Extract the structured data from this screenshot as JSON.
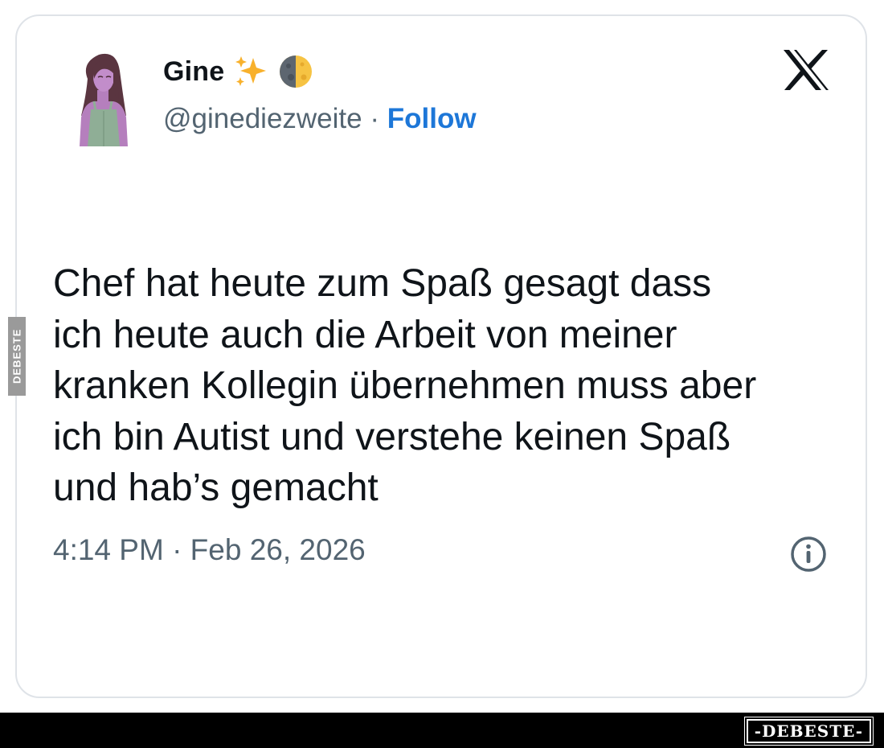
{
  "tweet": {
    "author_name": "Gine",
    "emojis": [
      "sparkles-emoji",
      "last-quarter-moon-emoji"
    ],
    "handle": "@ginediezweite",
    "separator": " · ",
    "follow_label": "Follow",
    "text": "Chef hat heute zum Spaß gesagt dass\nich heute auch die Arbeit von meiner\nkranken Kollegin übernehmen muss aber\nich bin Autist und verstehe keinen Spaß\nund hab’s gemacht",
    "timestamp": "4:14 PM · Feb 26, 2026",
    "icons": {
      "platform": "x-logo-icon",
      "info": "info-icon"
    }
  },
  "watermark": {
    "side_text": "DEBESTE",
    "footer_text": "-DEBESTE-"
  },
  "colors": {
    "follow": "#1d77d8",
    "muted": "#536471",
    "text": "#0f1419",
    "card_border": "#dfe3e8"
  }
}
